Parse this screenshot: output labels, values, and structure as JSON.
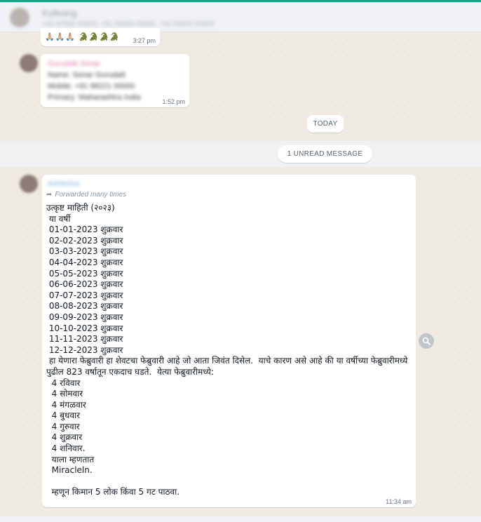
{
  "header": {
    "name": "Kolkoing",
    "subtitle": "+91 97000 00000, +91 00000 00000, +91 00000 00000"
  },
  "messages": [
    {
      "id": "m1",
      "content": "🙏🏼🙏🏼🙏🏼 🐊🐊🐊🐊",
      "time": "3:27 pm"
    },
    {
      "id": "m2",
      "sender": "Gurudatt Sonar",
      "lines": [
        "Name: Sonar Gurudatt",
        "Mobile: +91 98221 00000",
        "Primary: Maharashtra India"
      ],
      "time": "1:52 pm"
    },
    {
      "id": "m3",
      "sender": "Ashlesha",
      "forwarded": "Forwarded many times",
      "body": "उत्कृष्ट माहिती (२०२३)\n या वर्षी\n 01-01-2023 शुक्रवार\n 02-02-2023 शुक्रवार\n 03-03-2023 शुक्रवार\n 04-04-2023 शुक्रवार\n 05-05-2023 शुक्रवार\n 06-06-2023 शुक्रवार\n 07-07-2023 शुक्रवार\n 08-08-2023 शुक्रवार\n 09-09-2023 शुक्रवार\n 10-10-2023 शुक्रवार\n 11-11-2023 शुक्रवार\n 12-12-2023 शुक्रवार\n हा येणारा फेब्रुवारी हा शेवटचा फेब्रुवारी आहे जो आता जिवंत दिसेल.  याचे कारण असे आहे की या वर्षीच्या फेब्रुवारीमध्ये पुढील 823 वर्षातून एकदाच घडते.  येत्या फेब्रुवारीमध्ये:\n  4 रविवार\n  4 सोमवार\n  4 मंगळवार\n  4 बुधवार\n  4 गुरुवार\n  4 शुक्रवार\n  4 शनिवार.\n  याला म्हणतात\n  Miracleln.\n\n  म्हणून किमान 5 लोक किंवा 5 गट पाठवा.",
      "time": "11:34 am"
    }
  ],
  "dividers": {
    "today": "TODAY",
    "unread": "1 UNREAD MESSAGE"
  },
  "icons": {
    "forward": "forward-arrow-icon",
    "search": "search-icon"
  },
  "colors": {
    "accent": "#00a884",
    "background": "#efeae2",
    "bubble": "#ffffff"
  }
}
